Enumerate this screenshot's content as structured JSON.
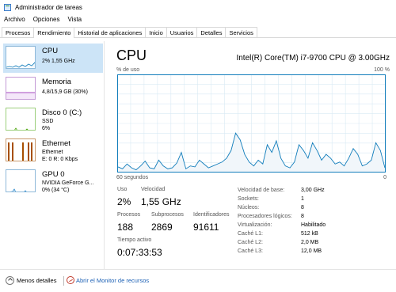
{
  "window": {
    "title": "Administrador de tareas"
  },
  "menu": [
    "Archivo",
    "Opciones",
    "Vista"
  ],
  "tabs": [
    "Procesos",
    "Rendimiento",
    "Historial de aplicaciones",
    "Inicio",
    "Usuarios",
    "Detalles",
    "Servicios"
  ],
  "sidebar": {
    "items": [
      {
        "name": "CPU",
        "sub1": "2% 1,55 GHz",
        "sub2": "",
        "sub3": ""
      },
      {
        "name": "Memoria",
        "sub1": "4,8/15,9 GB (30%)",
        "sub2": "",
        "sub3": ""
      },
      {
        "name": "Disco 0 (C:)",
        "sub1": "SSD",
        "sub2": "6%",
        "sub3": ""
      },
      {
        "name": "Ethernet",
        "sub1": "Ethernet",
        "sub2": "E: 0 R: 0 Kbps",
        "sub3": ""
      },
      {
        "name": "GPU 0",
        "sub1": "NVIDIA GeForce G...",
        "sub2": "0% (34 °C)",
        "sub3": ""
      }
    ]
  },
  "main": {
    "title": "CPU",
    "model": "Intel(R) Core(TM) i7-9700 CPU @ 3.00GHz",
    "graph_label_top_left": "% de uso",
    "graph_label_top_right": "100 %",
    "graph_label_bottom_left": "60 segundos",
    "graph_label_bottom_right": "0",
    "usage_series": [
      5,
      3,
      8,
      4,
      2,
      6,
      11,
      4,
      3,
      12,
      6,
      3,
      4,
      9,
      20,
      3,
      6,
      5,
      12,
      8,
      4,
      6,
      8,
      10,
      14,
      22,
      40,
      33,
      18,
      10,
      6,
      12,
      8,
      28,
      20,
      32,
      14,
      6,
      4,
      10,
      28,
      22,
      14,
      30,
      22,
      12,
      18,
      14,
      8,
      10,
      6,
      14,
      24,
      18,
      6,
      8,
      12,
      30,
      22,
      4
    ],
    "stats": [
      {
        "label": "Uso",
        "value": "2%"
      },
      {
        "label": "Velocidad",
        "value": "1,55 GHz"
      },
      {
        "label": "Procesos",
        "value": "188"
      },
      {
        "label": "Subprocesos",
        "value": "2869"
      },
      {
        "label": "Identificadores",
        "value": "91611"
      },
      {
        "label": "Tiempo activo",
        "value": "0:07:33:53"
      }
    ],
    "specs": [
      {
        "label": "Velocidad de base:",
        "value": "3,00 GHz"
      },
      {
        "label": "Sockets:",
        "value": "1"
      },
      {
        "label": "Núcleos:",
        "value": "8"
      },
      {
        "label": "Procesadores lógicos:",
        "value": "8"
      },
      {
        "label": "Virtualización:",
        "value": "Habilitado"
      },
      {
        "label": "Caché L1:",
        "value": "512 kB"
      },
      {
        "label": "Caché L2:",
        "value": "2,0 MB"
      },
      {
        "label": "Caché L3:",
        "value": "12,0 MB"
      }
    ]
  },
  "footer": {
    "less_details": "Menos detalles",
    "open_monitor": "Abrir el Monitor de recursos"
  },
  "colors": {
    "accent": "#117dbb",
    "graph_fill": "#f1f6fa",
    "grid": "#d9eaf4",
    "memory": "#8b12ae",
    "disk": "#4da60c",
    "ethernet": "#a74f01",
    "gpu": "#1c80c8"
  }
}
